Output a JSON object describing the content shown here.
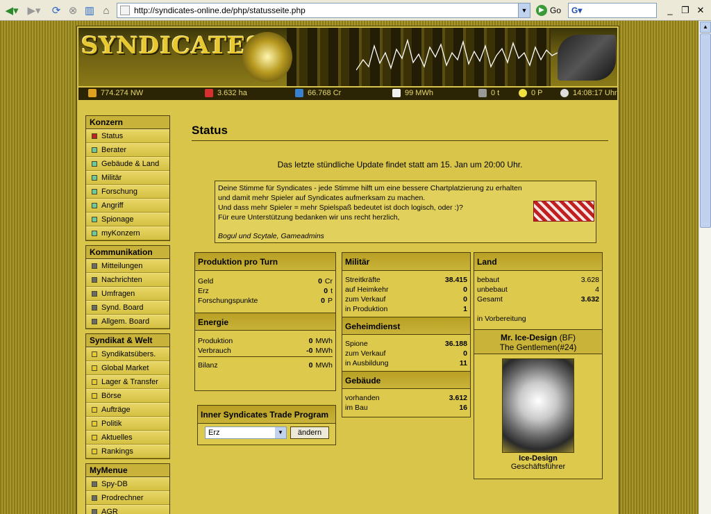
{
  "browser": {
    "url": "http://syndicates-online.de/php/statusseite.php",
    "go_label": "Go"
  },
  "statusbar": {
    "networth": "774.274 NW",
    "land": "3.632 ha",
    "credits": "66.768 Cr",
    "energy": "99 MWh",
    "ore": "0 t",
    "research": "0 P",
    "time": "14:08:17 Uhr"
  },
  "sidebar": {
    "konzern": {
      "title": "Konzern",
      "items": [
        "Status",
        "Berater",
        "Gebäude & Land",
        "Militär",
        "Forschung",
        "Angriff",
        "Spionage",
        "myKonzern"
      ]
    },
    "kommunikation": {
      "title": "Kommunikation",
      "items": [
        "Mitteilungen",
        "Nachrichten",
        "Umfragen",
        "Synd. Board",
        "Allgem. Board"
      ]
    },
    "syndikat": {
      "title": "Syndikat & Welt",
      "items": [
        "Syndikatsübers.",
        "Global Market",
        "Lager & Transfer",
        "Börse",
        "Aufträge",
        "Politik",
        "Aktuelles",
        "Rankings"
      ]
    },
    "mymenue": {
      "title": "MyMenue",
      "items": [
        "Spy-DB",
        "Prodrechner",
        "AGR"
      ]
    }
  },
  "main": {
    "title": "Status",
    "update_msg": "Das letzte stündliche Update findet statt am 15. Jan um 20:00 Uhr.",
    "vote": {
      "line1": "Deine Stimme für Syndicates - jede Stimme hilft um eine bessere Chartplatzierung zu erhalten",
      "line2": "und damit mehr Spieler auf Syndicates aufmerksam zu machen.",
      "line3": "Und dass mehr Spieler = mehr Spielspaß bedeutet ist doch logisch, oder :)?",
      "line4": "Für eure Unterstützung bedanken wir uns recht herzlich,",
      "signature": "Bogul und Scytale, Gameadmins"
    }
  },
  "produktion": {
    "title": "Produktion pro Turn",
    "rows": [
      {
        "label": "Geld",
        "value": "0",
        "unit": "Cr"
      },
      {
        "label": "Erz",
        "value": "0",
        "unit": "t"
      },
      {
        "label": "Forschungspunkte",
        "value": "0",
        "unit": "P"
      }
    ]
  },
  "energie": {
    "title": "Energie",
    "rows": [
      {
        "label": "Produktion",
        "value": "0",
        "unit": "MWh"
      },
      {
        "label": "Verbrauch",
        "value": "-0",
        "unit": "MWh"
      },
      {
        "label": "Bilanz",
        "value": "0",
        "unit": "MWh"
      }
    ]
  },
  "militaer": {
    "title": "Militär",
    "rows": [
      {
        "label": "Streitkräfte",
        "value": "38.415"
      },
      {
        "label": "auf Heimkehr",
        "value": "0"
      },
      {
        "label": "zum Verkauf",
        "value": "0"
      },
      {
        "label": "in Produktion",
        "value": "1"
      }
    ]
  },
  "geheimdienst": {
    "title": "Geheimdienst",
    "rows": [
      {
        "label": "Spione",
        "value": "36.188"
      },
      {
        "label": "zum Verkauf",
        "value": "0"
      },
      {
        "label": "in Ausbildung",
        "value": "11"
      }
    ]
  },
  "gebaeude": {
    "title": "Gebäude",
    "rows": [
      {
        "label": "vorhanden",
        "value": "3.612"
      },
      {
        "label": "im Bau",
        "value": "16"
      }
    ]
  },
  "land": {
    "title": "Land",
    "rows": [
      {
        "label": "bebaut",
        "value": "3.628"
      },
      {
        "label": "unbebaut",
        "value": "4"
      },
      {
        "label": "Gesamt",
        "value": "3.632"
      }
    ],
    "preparation": "in Vorbereitung"
  },
  "profile": {
    "name": "Mr. Ice-Design",
    "tag": "(BF)",
    "syndicate": "The Gentlemen(#24)",
    "username": "Ice-Design",
    "role": "Geschäftsführer"
  },
  "inner_trade": {
    "title": "Inner Syndicates Trade Program",
    "selected": "Erz",
    "button": "ändern"
  },
  "colors": {
    "page_bg": "#d9c54a",
    "frame": "#4a3f05",
    "box_head": "#c2ab30"
  }
}
